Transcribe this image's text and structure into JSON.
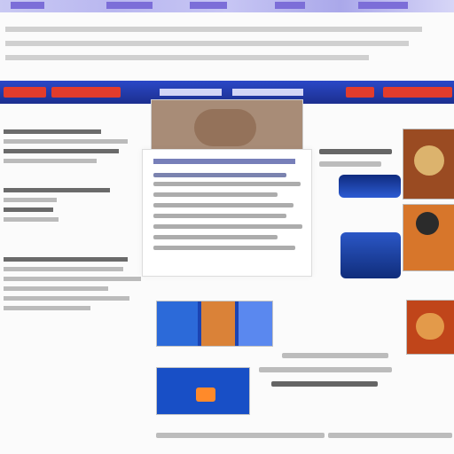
{
  "page": {
    "header": {
      "lines": [
        "",
        "",
        ""
      ]
    },
    "nav": {
      "left_label": "",
      "right_label": ""
    },
    "left_column": {
      "items": [
        "",
        "",
        "",
        "",
        "",
        "",
        "",
        "",
        "",
        "",
        "",
        "",
        ""
      ]
    },
    "hero": {
      "headline": "",
      "snippet": ""
    },
    "right_column": {
      "captions": [
        "",
        "",
        ""
      ]
    },
    "bottom": {
      "captions": [
        "",
        ""
      ]
    }
  },
  "icons": {
    "photo_icon": "image-icon"
  }
}
